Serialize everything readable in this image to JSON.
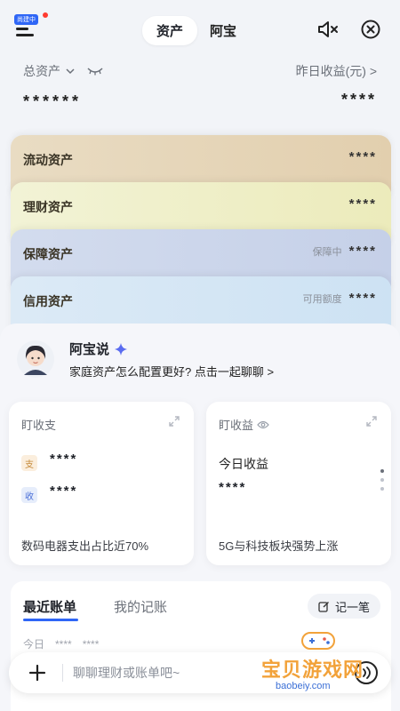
{
  "header": {
    "menu_badge": "尚建中",
    "tab_active": "资产",
    "tab_other": "阿宝"
  },
  "summary": {
    "total_label": "总资产",
    "total_value": "******",
    "yesterday_label": "昨日收益(元) >",
    "yesterday_value": "****"
  },
  "asset_cards": [
    {
      "title": "流动资产",
      "hint": "",
      "value": "****",
      "color": "#e6d7bd"
    },
    {
      "title": "理财资产",
      "hint": "",
      "value": "****",
      "color": "#eff0c9"
    },
    {
      "title": "保障资产",
      "hint": "保障中",
      "value": "****",
      "color": "#cdd7eb"
    },
    {
      "title": "信用资产",
      "hint": "可用额度",
      "value": "****",
      "color": "#d6e7f6"
    }
  ],
  "assistant": {
    "title": "阿宝说",
    "subtitle": "家庭资产怎么配置更好? 点击一起聊聊 >"
  },
  "panels": {
    "spend": {
      "title": "盯收支",
      "income_tag": "支",
      "income_value": "****",
      "expense_tag": "收",
      "expense_value": "****",
      "footer": "数码电器支出占比近70%"
    },
    "earn": {
      "title": "盯收益",
      "today_label": "今日收益",
      "today_value": "****",
      "footer": "5G与科技板块强势上涨"
    }
  },
  "bills": {
    "tab_active": "最近账单",
    "tab_other": "我的记账",
    "record_label": "记一笔",
    "row_label": "今日",
    "row_value_1": "****",
    "row_value_2": "****"
  },
  "chat": {
    "placeholder": "聊聊理财或账单吧~"
  },
  "watermark": {
    "text": "宝贝游戏网",
    "url": "baobeiy.com"
  }
}
